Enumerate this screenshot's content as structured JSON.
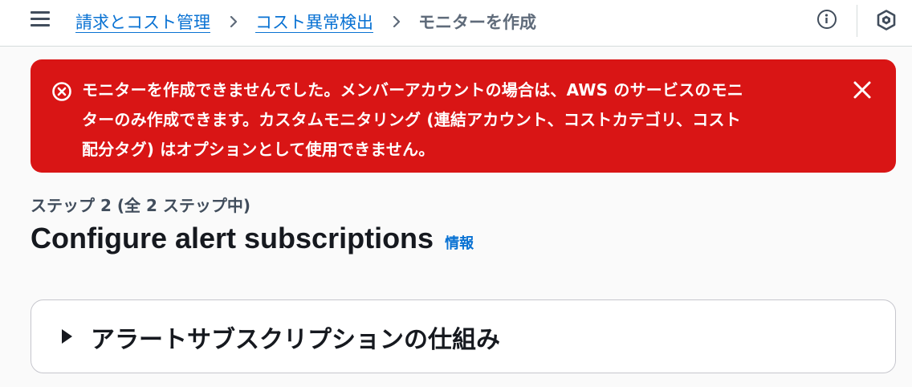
{
  "breadcrumb": {
    "items": [
      "請求とコスト管理",
      "コスト異常検出"
    ],
    "current": "モニターを作成"
  },
  "header_icons": [
    "menu-icon",
    "info-icon",
    "cloudshell-icon"
  ],
  "flash": {
    "type": "error",
    "message_lines": [
      "モニターを作成できませんでした。メンバーアカウントの場合は、AWS のサービスのモニ",
      "ターのみ作成できます。カスタムモニタリング (連結アカウント、コストカテゴリ、コスト",
      "配分タグ) はオプションとして使用できません。"
    ],
    "color": "#d91515"
  },
  "step": {
    "label": "ステップ 2 (全 2 ステップ中)",
    "title": "Configure alert subscriptions",
    "info_link": "情報"
  },
  "expander": {
    "title": "アラートサブスクリプションの仕組み",
    "expanded": false
  },
  "colors": {
    "link": "#0972d3",
    "error": "#d91515",
    "text": "#16191f"
  }
}
